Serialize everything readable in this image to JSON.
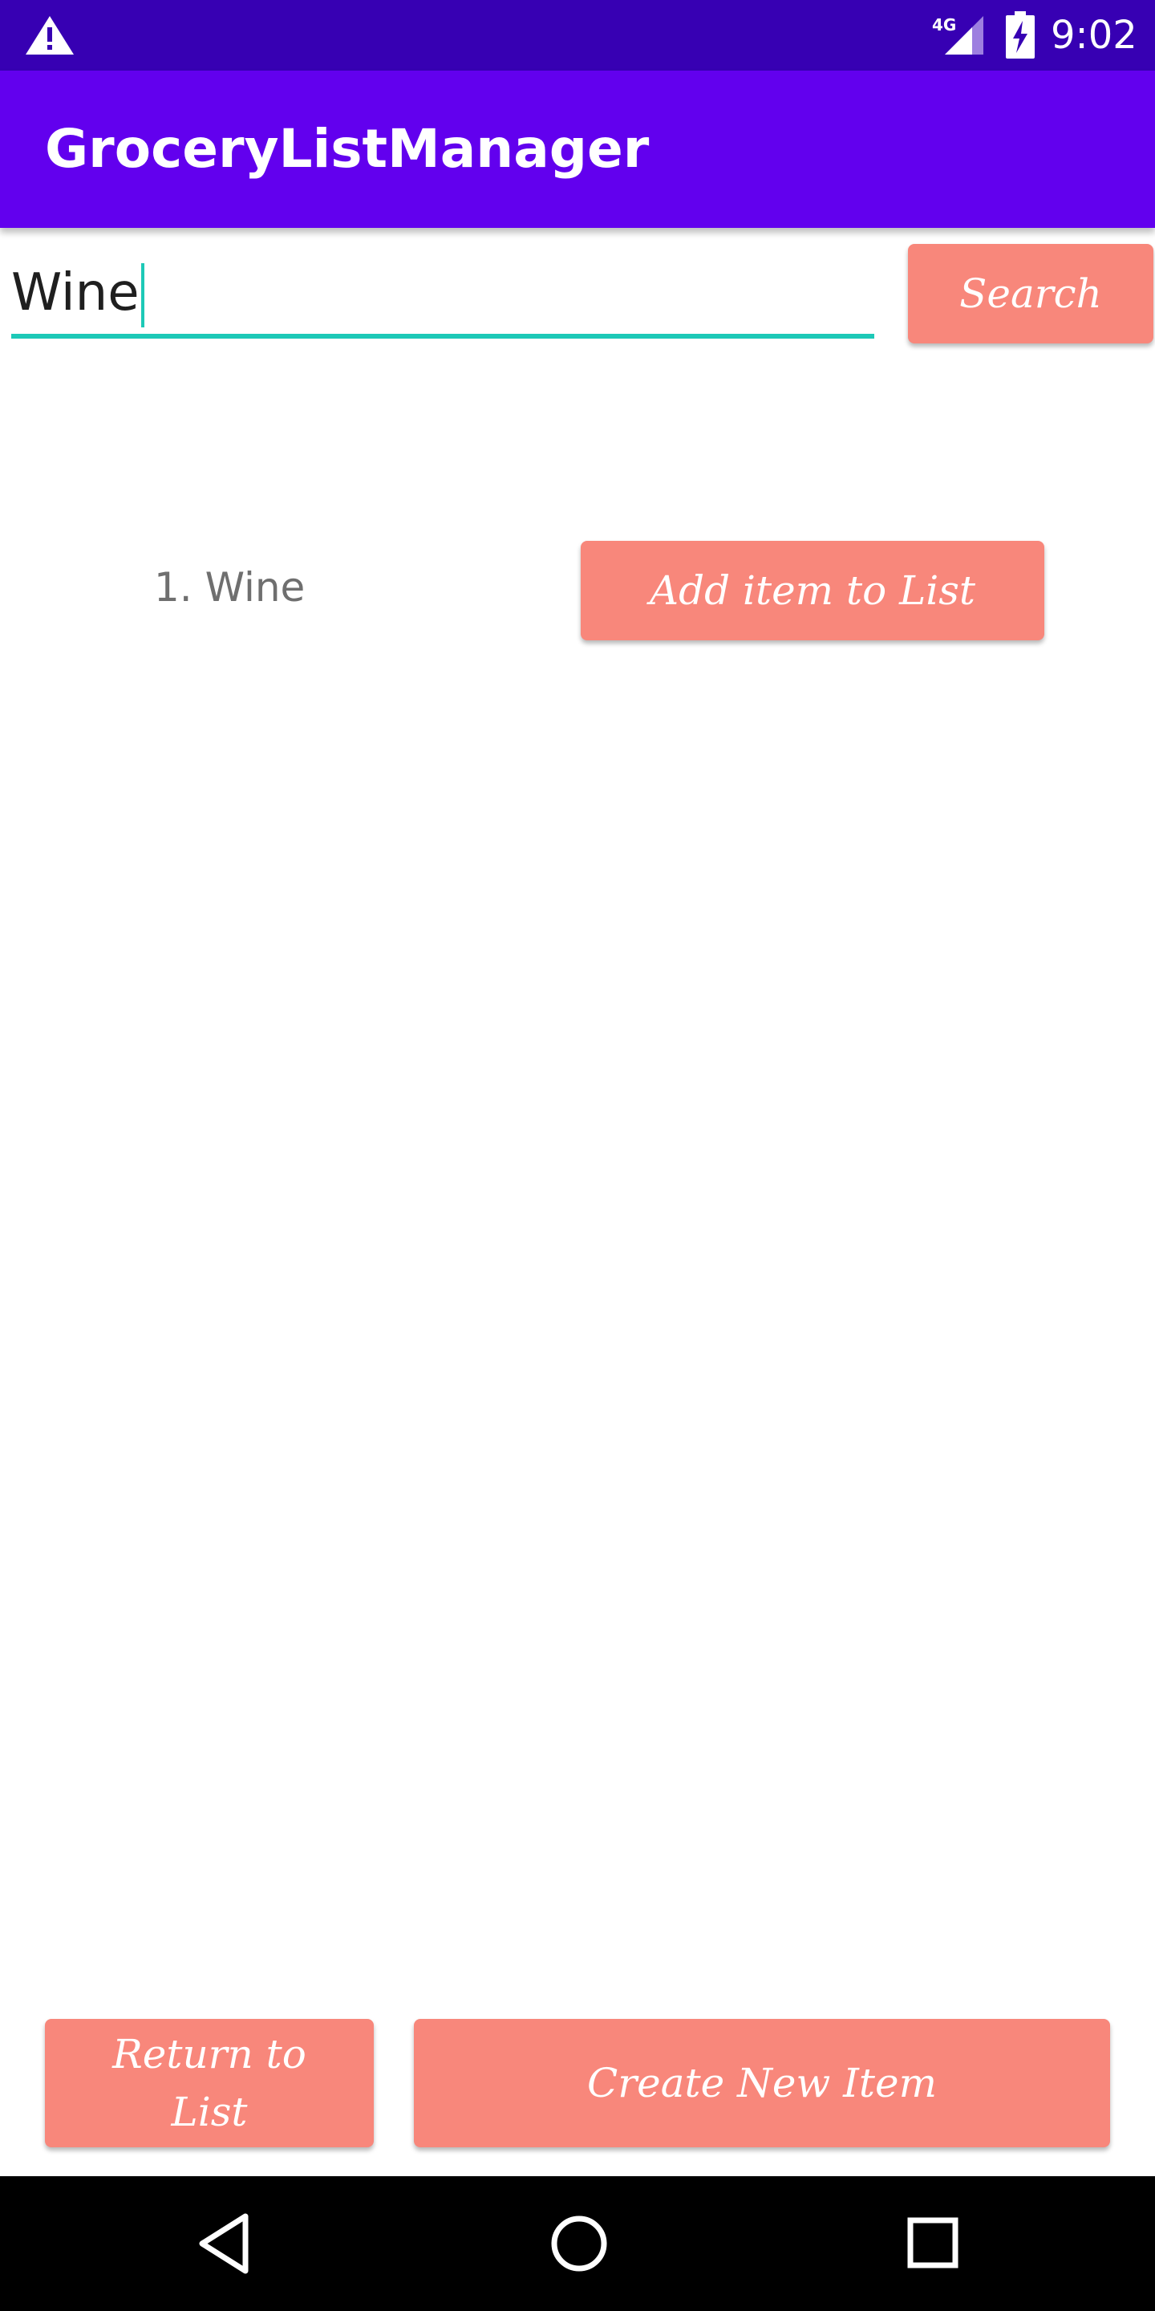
{
  "status_bar": {
    "time": "9:02",
    "network": "4G",
    "icons": [
      "warning-icon",
      "signal-icon",
      "battery-charging-icon"
    ]
  },
  "app_bar": {
    "title": "GroceryListManager",
    "color": "#6200ee"
  },
  "search": {
    "value": "Wine",
    "button_label": "Search",
    "accent_color": "#1dc9b7"
  },
  "results": [
    {
      "label": "1. Wine",
      "button_label": "Add item to List"
    }
  ],
  "bottom_actions": {
    "return_label": "Return to List",
    "create_label": "Create New Item"
  },
  "nav_bar": {
    "icons": [
      "back-icon",
      "home-icon",
      "recents-icon"
    ]
  },
  "colors": {
    "status_bar": "#3700b3",
    "button": "#f8877b"
  }
}
